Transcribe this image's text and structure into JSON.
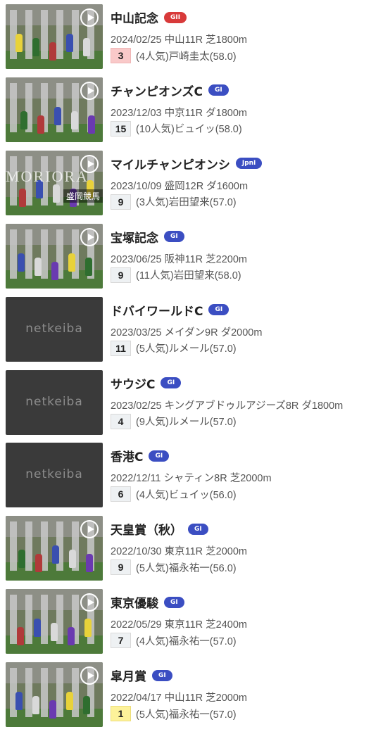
{
  "colors": {
    "grade_g1": "#3b4ec2",
    "grade_g2": "#d83a3a",
    "finish_red": "#f9c9c9",
    "finish_yellow": "#fdf29a"
  },
  "placeholder_logo": "netkeiba",
  "races": [
    {
      "name": "中山記念",
      "grade": "GII",
      "grade_color": "#d83a3a",
      "date": "2024/02/25",
      "course": "中山11R 芝1800m",
      "finish": "3",
      "finish_style": "red",
      "popularity": "(4人気)",
      "jockey": "戸崎圭太(58.0)",
      "thumb": "video",
      "thumb_icon": "play-icon"
    },
    {
      "name": "チャンピオンズC",
      "grade": "GI",
      "grade_color": "#3b4ec2",
      "date": "2023/12/03",
      "course": "中京11R ダ1800m",
      "finish": "15",
      "finish_style": "",
      "popularity": "(10人気)",
      "jockey": "ビュイッ(58.0)",
      "thumb": "video",
      "thumb_icon": "play-icon"
    },
    {
      "name": "マイルチャンピオンシ",
      "grade": "JpnI",
      "grade_color": "#3b4ec2",
      "date": "2023/10/09",
      "course": "盛岡12R ダ1600m",
      "finish": "9",
      "finish_style": "",
      "popularity": "(3人気)",
      "jockey": "岩田望来(57.0)",
      "thumb": "video",
      "thumb_icon": "play-icon",
      "thumb_text": "MORIORA",
      "thumb_caption": "盛岡競馬"
    },
    {
      "name": "宝塚記念",
      "grade": "GI",
      "grade_color": "#3b4ec2",
      "date": "2023/06/25",
      "course": "阪神11R 芝2200m",
      "finish": "9",
      "finish_style": "",
      "popularity": "(11人気)",
      "jockey": "岩田望来(58.0)",
      "thumb": "video",
      "thumb_icon": "play-icon"
    },
    {
      "name": "ドバイワールドC",
      "grade": "GI",
      "grade_color": "#3b4ec2",
      "date": "2023/03/25",
      "course": "メイダン9R ダ2000m",
      "finish": "11",
      "finish_style": "",
      "popularity": "(5人気)",
      "jockey": "ルメール(57.0)",
      "thumb": "placeholder"
    },
    {
      "name": "サウジC",
      "grade": "GI",
      "grade_color": "#3b4ec2",
      "date": "2023/02/25",
      "course": "キングアブドゥルアジーズ8R ダ1800m",
      "finish": "4",
      "finish_style": "",
      "popularity": "(9人気)",
      "jockey": "ルメール(57.0)",
      "thumb": "placeholder"
    },
    {
      "name": "香港C",
      "grade": "GI",
      "grade_color": "#3b4ec2",
      "date": "2022/12/11",
      "course": "シャティン8R 芝2000m",
      "finish": "6",
      "finish_style": "",
      "popularity": "(4人気)",
      "jockey": "ビュイッ(56.0)",
      "thumb": "placeholder"
    },
    {
      "name": "天皇賞（秋）",
      "grade": "GI",
      "grade_color": "#3b4ec2",
      "date": "2022/10/30",
      "course": "東京11R 芝2000m",
      "finish": "9",
      "finish_style": "",
      "popularity": "(5人気)",
      "jockey": "福永祐一(56.0)",
      "thumb": "video",
      "thumb_icon": "play-icon"
    },
    {
      "name": "東京優駿",
      "grade": "GI",
      "grade_color": "#3b4ec2",
      "date": "2022/05/29",
      "course": "東京11R 芝2400m",
      "finish": "7",
      "finish_style": "",
      "popularity": "(4人気)",
      "jockey": "福永祐一(57.0)",
      "thumb": "video",
      "thumb_icon": "play-icon"
    },
    {
      "name": "皐月賞",
      "grade": "GI",
      "grade_color": "#3b4ec2",
      "date": "2022/04/17",
      "course": "中山11R 芝2000m",
      "finish": "1",
      "finish_style": "yellow",
      "popularity": "(5人気)",
      "jockey": "福永祐一(57.0)",
      "thumb": "video",
      "thumb_icon": "play-icon"
    }
  ]
}
